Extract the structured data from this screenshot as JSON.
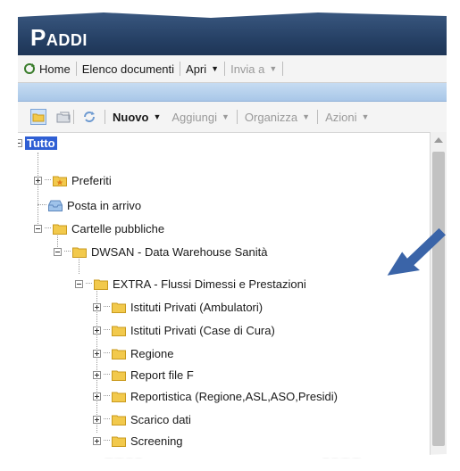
{
  "app": {
    "title_first": "P",
    "title_rest": "ADDI"
  },
  "menubar": {
    "home": "Home",
    "documents": "Elenco documenti",
    "open": "Apri",
    "send_to": "Invia a"
  },
  "toolbar": {
    "new": "Nuovo",
    "add": "Aggiungi",
    "organize": "Organizza",
    "actions": "Azioni"
  },
  "tree": {
    "root": "Tutto",
    "favorites": "Preferiti",
    "inbox": "Posta in arrivo",
    "public_folders": "Cartelle pubbliche",
    "dwsan": "DWSAN - Data Warehouse Sanità",
    "extra": "EXTRA - Flussi Dimessi e Prestazioni",
    "children": [
      "Istituti Privati (Ambulatori)",
      "Istituti Privati (Case di Cura)",
      "Regione",
      "Report file F",
      "Reportistica (Regione,ASL,ASO,Presidi)",
      "Scarico dati",
      "Screening"
    ]
  },
  "colors": {
    "titlebar": "#2a4670",
    "selection": "#2f5fd4",
    "arrow": "#3a64a8",
    "folder": "#f2c94c"
  }
}
